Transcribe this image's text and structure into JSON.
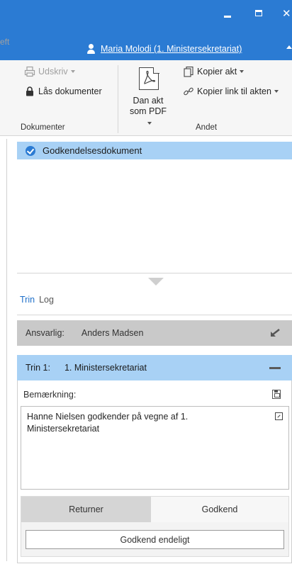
{
  "window": {
    "user_link": "Maria Molodi (1. Ministersekretariat)"
  },
  "ribbon": {
    "cut_label": "eft",
    "print_label": "Udskriv",
    "lock_label": "Lås dokumenter",
    "pdf_label_1": "Dan akt",
    "pdf_label_2": "som PDF",
    "copy_act_label": "Kopier akt",
    "copy_link_label": "Kopier link til akten",
    "group_documents": "Dokumenter",
    "group_other": "Andet"
  },
  "documents": [
    {
      "name": "Godkendelsesdokument",
      "status": "approved"
    }
  ],
  "tabs": [
    {
      "label": "Trin",
      "active": true
    },
    {
      "label": "Log",
      "active": false
    }
  ],
  "responsible": {
    "label": "Ansvarlig:",
    "name": "Anders Madsen"
  },
  "step": {
    "label": "Trin 1:",
    "name": "1. Ministersekretariat",
    "remark_label": "Bemærkning:",
    "remark_text": "Hanne Nielsen godkender på vegne af 1. Ministersekretariat"
  },
  "actions": {
    "return_label": "Returner",
    "approve_label": "Godkend",
    "final_label": "Godkend endeligt"
  },
  "colors": {
    "titlebar": "#2b7bd3",
    "selection": "#a8d1f5",
    "responsible_bar": "#c9c9c9"
  }
}
